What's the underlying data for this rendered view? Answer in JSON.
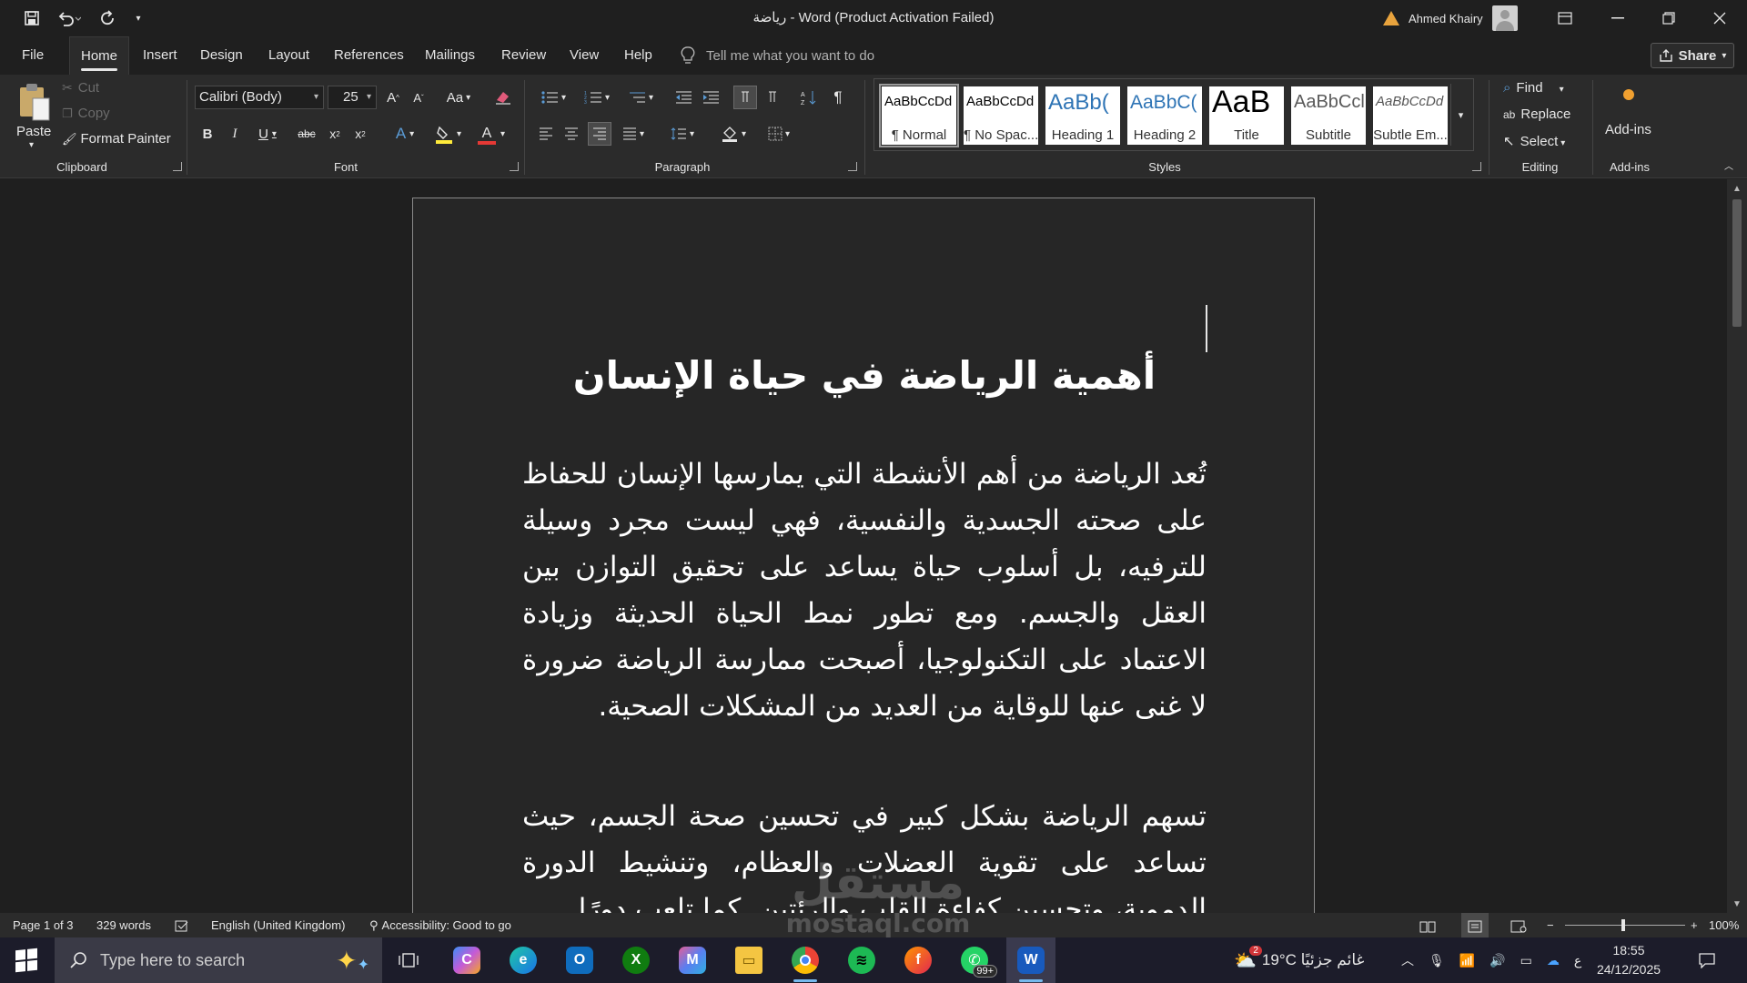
{
  "titlebar": {
    "document_title": "رياضة  -  Word (Product Activation Failed)",
    "user_name": "Ahmed Khairy",
    "qat": [
      "save-icon",
      "undo-icon",
      "redo-icon",
      "customize-icon"
    ],
    "controls": [
      "ribbon-display-icon",
      "minimize-icon",
      "restore-icon",
      "close-icon"
    ]
  },
  "tabs": {
    "items": [
      "File",
      "Home",
      "Insert",
      "Design",
      "Layout",
      "References",
      "Mailings",
      "Review",
      "View",
      "Help"
    ],
    "active": "Home",
    "tell_me": "Tell me what you want to do",
    "share": "Share"
  },
  "ribbon": {
    "clipboard": {
      "label": "Clipboard",
      "paste": "Paste",
      "cut": "Cut",
      "copy": "Copy",
      "format_painter": "Format Painter"
    },
    "font": {
      "label": "Font",
      "font_name": "Calibri (Body)",
      "font_size": "25",
      "case_button": "Aa",
      "font_color": "#e53935",
      "highlight_color": "#ffeb3b"
    },
    "paragraph": {
      "label": "Paragraph"
    },
    "styles": {
      "label": "Styles",
      "items": [
        {
          "sample": "AaBbCcDd",
          "name": "¶ Normal"
        },
        {
          "sample": "AaBbCcDd",
          "name": "¶ No Spac..."
        },
        {
          "sample": "AaBb(",
          "name": "Heading 1"
        },
        {
          "sample": "AaBbC(",
          "name": "Heading 2"
        },
        {
          "sample": "AaB",
          "name": "Title"
        },
        {
          "sample": "AaBbCcl",
          "name": "Subtitle"
        },
        {
          "sample": "AaBbCcDd",
          "name": "Subtle Em..."
        }
      ]
    },
    "editing": {
      "label": "Editing",
      "find": "Find",
      "replace": "Replace",
      "select": "Select"
    },
    "addins": {
      "label": "Add-ins",
      "button": "Add-ins"
    }
  },
  "document": {
    "heading": "أهمية الرياضة في حياة الإنسان",
    "paragraphs": [
      "تُعد الرياضة من أهم الأنشطة التي يمارسها الإنسان للحفاظ على صحته الجسدية والنفسية، فهي ليست مجرد وسيلة للترفيه، بل أسلوب حياة يساعد على تحقيق التوازن بين العقل والجسم. ومع تطور نمط الحياة الحديثة وزيادة الاعتماد على التكنولوجيا، أصبحت ممارسة الرياضة ضرورة لا غنى عنها للوقاية من العديد من المشكلات الصحية.",
      "تسهم الرياضة بشكل كبير في تحسين صحة الجسم، حيث تساعد على تقوية العضلات والعظام، وتنشيط الدورة الدموية، وتحسين كفاءة القلب والرئتين. كما تلعب دورًا"
    ]
  },
  "statusbar": {
    "page": "Page 1 of 3",
    "words": "329 words",
    "language": "English (United Kingdom)",
    "accessibility": "Accessibility: Good to go",
    "zoom": "100%"
  },
  "taskbar": {
    "search_placeholder": "Type here to search",
    "weather": "19°C  غائم جزئيًا",
    "weather_badge": "2",
    "whatsapp_badge": "99+",
    "language_indicator": "ع",
    "time": "18:55",
    "date": "24/12/2025"
  },
  "watermark": {
    "arabic": "مستقل",
    "latin": "mostaql.com"
  }
}
